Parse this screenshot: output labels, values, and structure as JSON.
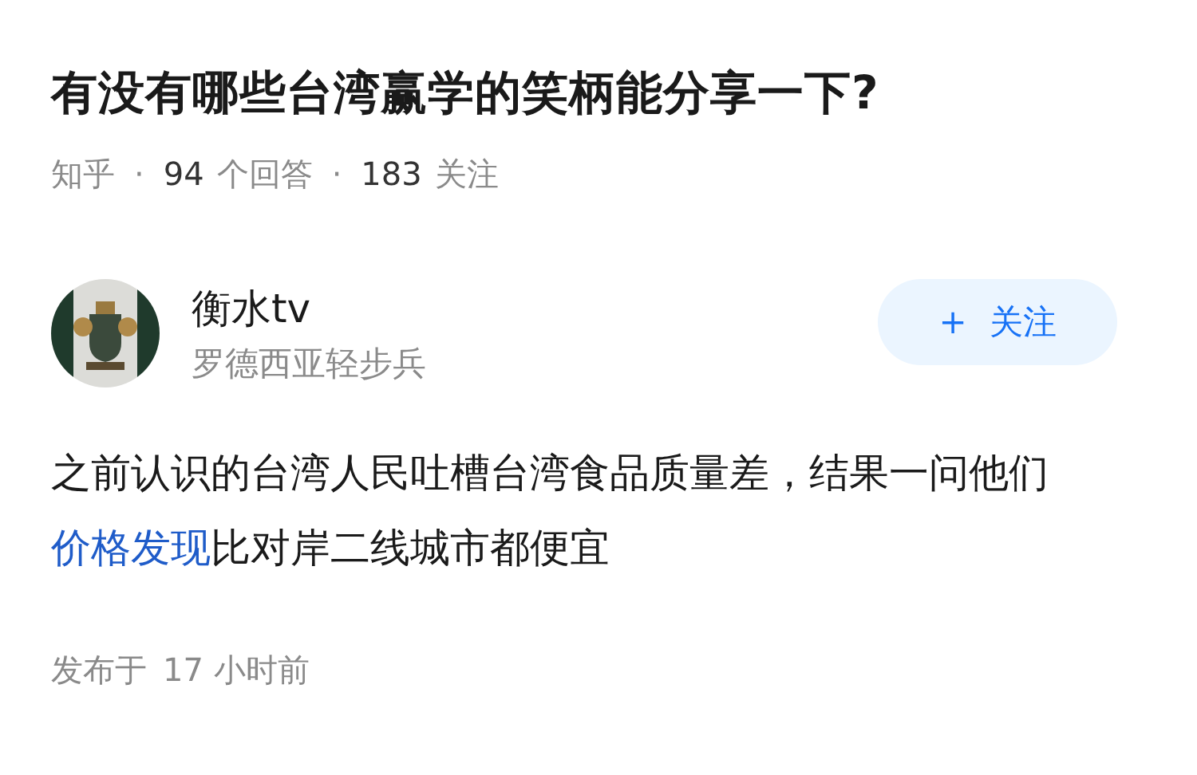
{
  "question": {
    "title": "有没有哪些台湾赢学的笑柄能分享一下?"
  },
  "meta": [
    {
      "kind": "source",
      "text": "知乎"
    },
    {
      "kind": "sep",
      "text": "·"
    },
    {
      "kind": "count",
      "number": "94",
      "label": "个回答"
    },
    {
      "kind": "sep",
      "text": "·"
    },
    {
      "kind": "count",
      "number": "183",
      "label": "关注"
    }
  ],
  "author": {
    "name": "衡水tv",
    "bio": "罗德西亚轻步兵"
  },
  "follow_button": {
    "icon": "+",
    "label": "关注"
  },
  "answer": {
    "parts": [
      {
        "kind": "text",
        "text": "之前认识的台湾人民吐槽台湾食品质量差，结果一问他们"
      },
      {
        "kind": "link",
        "text": "价格发现"
      },
      {
        "kind": "text",
        "text": "比对岸二线城市都便宜"
      }
    ]
  },
  "footer": {
    "label": "发布于",
    "time": "17 小时前"
  }
}
